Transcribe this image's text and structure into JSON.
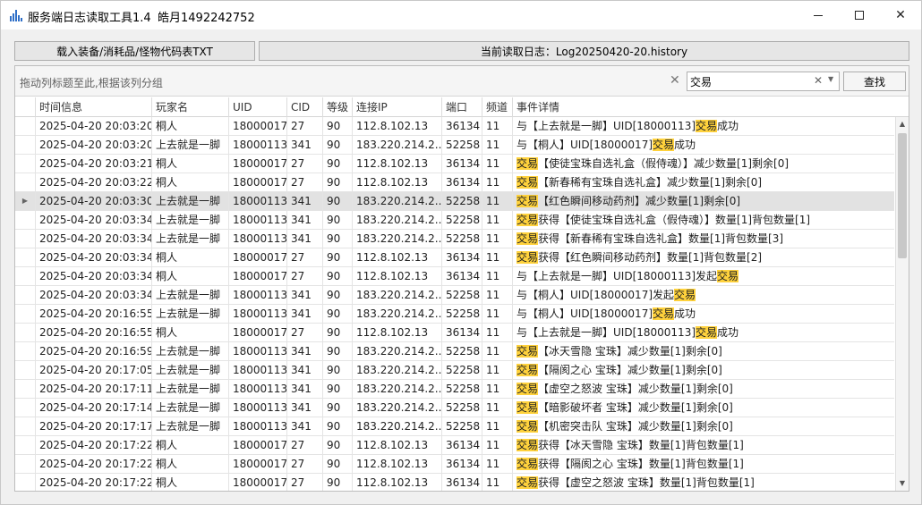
{
  "window": {
    "title": "服务端日志读取工具1.4",
    "user": "皓月1492242752"
  },
  "toolbar": {
    "load_label": "载入装备/消耗品/怪物代码表TXT",
    "current_log_label": "当前读取日志：Log20250420-20.history"
  },
  "grid": {
    "group_hint": "拖动列标题至此,根据该列分组",
    "search_value": "交易",
    "find_label": "查找",
    "columns": [
      "时间信息",
      "玩家名",
      "UID",
      "CID",
      "等级",
      "连接IP",
      "端口",
      "频道",
      "事件详情"
    ],
    "highlight": "交易",
    "selected_row": 4,
    "rows": [
      [
        "2025-04-20 20:03:20",
        "桐人",
        "18000017",
        "27",
        "90",
        "112.8.102.13",
        "36134",
        "11",
        "与【上去就是一脚】UID[18000113]交易成功"
      ],
      [
        "2025-04-20 20:03:20",
        "上去就是一脚",
        "18000113",
        "341",
        "90",
        "183.220.214.2...",
        "52258",
        "11",
        "与【桐人】UID[18000017]交易成功"
      ],
      [
        "2025-04-20 20:03:21",
        "桐人",
        "18000017",
        "27",
        "90",
        "112.8.102.13",
        "36134",
        "11",
        "交易【使徒宝珠自选礼盒（假侍魂）】减少数量[1]剩余[0]"
      ],
      [
        "2025-04-20 20:03:22",
        "桐人",
        "18000017",
        "27",
        "90",
        "112.8.102.13",
        "36134",
        "11",
        "交易【新春稀有宝珠自选礼盒】减少数量[1]剩余[0]"
      ],
      [
        "2025-04-20 20:03:30",
        "上去就是一脚",
        "18000113",
        "341",
        "90",
        "183.220.214.2...",
        "52258",
        "11",
        "交易【红色瞬间移动药剂】减少数量[1]剩余[0]"
      ],
      [
        "2025-04-20 20:03:34",
        "上去就是一脚",
        "18000113",
        "341",
        "90",
        "183.220.214.2...",
        "52258",
        "11",
        "交易获得【使徒宝珠自选礼盒（假侍魂）】数量[1]背包数量[1]"
      ],
      [
        "2025-04-20 20:03:34",
        "上去就是一脚",
        "18000113",
        "341",
        "90",
        "183.220.214.2...",
        "52258",
        "11",
        "交易获得【新春稀有宝珠自选礼盒】数量[1]背包数量[3]"
      ],
      [
        "2025-04-20 20:03:34",
        "桐人",
        "18000017",
        "27",
        "90",
        "112.8.102.13",
        "36134",
        "11",
        "交易获得【红色瞬间移动药剂】数量[1]背包数量[2]"
      ],
      [
        "2025-04-20 20:03:34",
        "桐人",
        "18000017",
        "27",
        "90",
        "112.8.102.13",
        "36134",
        "11",
        "与【上去就是一脚】UID[18000113]发起交易"
      ],
      [
        "2025-04-20 20:03:34",
        "上去就是一脚",
        "18000113",
        "341",
        "90",
        "183.220.214.2...",
        "52258",
        "11",
        "与【桐人】UID[18000017]发起交易"
      ],
      [
        "2025-04-20 20:16:55",
        "上去就是一脚",
        "18000113",
        "341",
        "90",
        "183.220.214.2...",
        "52258",
        "11",
        "与【桐人】UID[18000017]交易成功"
      ],
      [
        "2025-04-20 20:16:55",
        "桐人",
        "18000017",
        "27",
        "90",
        "112.8.102.13",
        "36134",
        "11",
        "与【上去就是一脚】UID[18000113]交易成功"
      ],
      [
        "2025-04-20 20:16:59",
        "上去就是一脚",
        "18000113",
        "341",
        "90",
        "183.220.214.2...",
        "52258",
        "11",
        "交易【冰天雪隐 宝珠】减少数量[1]剩余[0]"
      ],
      [
        "2025-04-20 20:17:05",
        "上去就是一脚",
        "18000113",
        "341",
        "90",
        "183.220.214.2...",
        "52258",
        "11",
        "交易【隔阂之心 宝珠】减少数量[1]剩余[0]"
      ],
      [
        "2025-04-20 20:17:11",
        "上去就是一脚",
        "18000113",
        "341",
        "90",
        "183.220.214.2...",
        "52258",
        "11",
        "交易【虚空之怒波 宝珠】减少数量[1]剩余[0]"
      ],
      [
        "2025-04-20 20:17:14",
        "上去就是一脚",
        "18000113",
        "341",
        "90",
        "183.220.214.2...",
        "52258",
        "11",
        "交易【暗影破坏者 宝珠】减少数量[1]剩余[0]"
      ],
      [
        "2025-04-20 20:17:17",
        "上去就是一脚",
        "18000113",
        "341",
        "90",
        "183.220.214.2...",
        "52258",
        "11",
        "交易【机密突击队 宝珠】减少数量[1]剩余[0]"
      ],
      [
        "2025-04-20 20:17:22",
        "桐人",
        "18000017",
        "27",
        "90",
        "112.8.102.13",
        "36134",
        "11",
        "交易获得【冰天雪隐 宝珠】数量[1]背包数量[1]"
      ],
      [
        "2025-04-20 20:17:22",
        "桐人",
        "18000017",
        "27",
        "90",
        "112.8.102.13",
        "36134",
        "11",
        "交易获得【隔阂之心 宝珠】数量[1]背包数量[1]"
      ],
      [
        "2025-04-20 20:17:22",
        "桐人",
        "18000017",
        "27",
        "90",
        "112.8.102.13",
        "36134",
        "11",
        "交易获得【虚空之怒波 宝珠】数量[1]背包数量[1]"
      ]
    ]
  },
  "colors": {
    "highlight": "#ffd23c",
    "selected_row": "#e2e2e2",
    "app_icon": "#2f6fc8"
  },
  "icons": {
    "app": "bar-chart-icon",
    "minimize": "minimize-icon",
    "maximize": "maximize-icon",
    "close": "close-icon",
    "row_indicator": "triangle-right-icon"
  }
}
